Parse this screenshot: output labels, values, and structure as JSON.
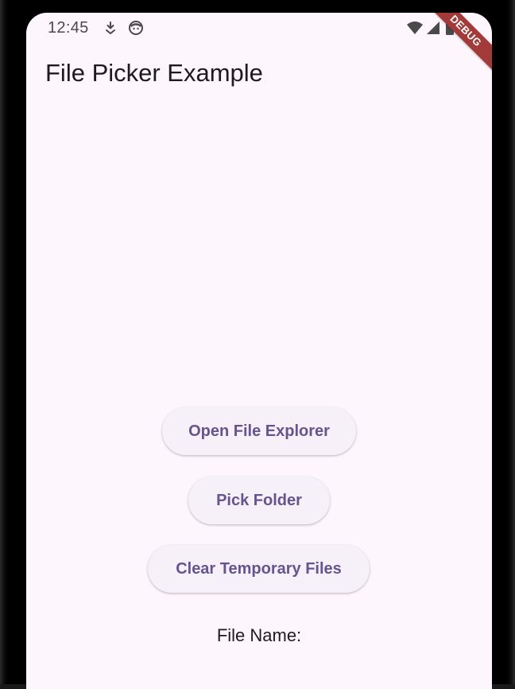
{
  "status_bar": {
    "time": "12:45",
    "icons_left": [
      "download-icon",
      "face-icon"
    ],
    "icons_right": [
      "wifi-icon",
      "cell-signal-icon",
      "battery-icon"
    ]
  },
  "debug_banner": "DEBUG",
  "app_bar": {
    "title": "File Picker Example"
  },
  "actions": {
    "open_file_explorer": "Open File Explorer",
    "pick_folder": "Pick Folder",
    "clear_temporary_files": "Clear Temporary Files"
  },
  "file_info": {
    "file_name_label": "File Name:"
  },
  "colors": {
    "background": "#fdf6fd",
    "button_text": "#65558f",
    "button_bg": "#f6f0f8",
    "debug_banner": "#a33a3a"
  }
}
